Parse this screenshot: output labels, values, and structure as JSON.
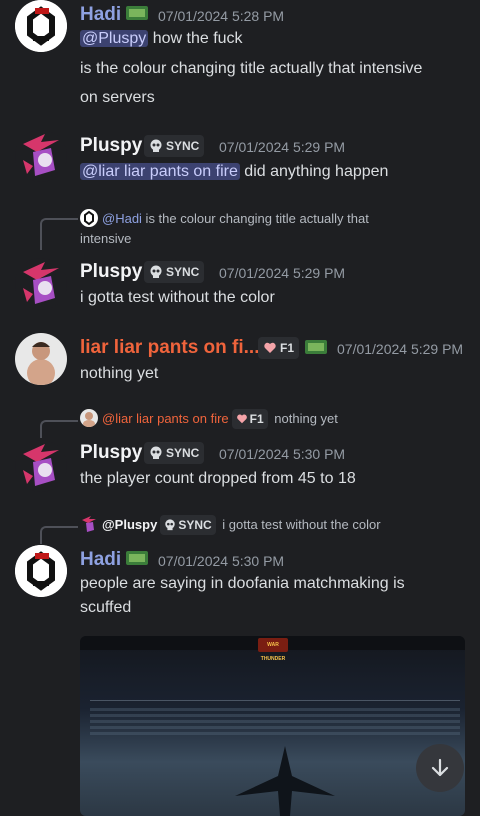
{
  "messages": [
    {
      "author": "Hadi",
      "timestamp": "07/01/2024 5:28 PM",
      "mention": "@Pluspy",
      "line1_rest": " how the fuck",
      "line2": "is the colour changing title actually that intensive",
      "line3": "on servers"
    },
    {
      "author": "Pluspy",
      "tag": "SYNC",
      "timestamp": "07/01/2024 5:29 PM",
      "mention": "@liar liar pants on fire",
      "line1_rest": " did anything happen"
    },
    {
      "reply": {
        "author": "@Hadi",
        "text": " is the colour changing title actually that",
        "text2": "intensive"
      },
      "author": "Pluspy",
      "tag": "SYNC",
      "timestamp": "07/01/2024 5:29 PM",
      "line1": "i gotta test without the color"
    },
    {
      "author": "liar liar pants on fi...",
      "tag": "F1",
      "timestamp": "07/01/2024 5:29 PM",
      "line1": "nothing yet"
    },
    {
      "reply": {
        "author": "@liar liar pants on fire",
        "tag": "F1",
        "text": " nothing yet"
      },
      "author": "Pluspy",
      "tag": "SYNC",
      "timestamp": "07/01/2024 5:30 PM",
      "line1": "the player count dropped from 45 to 18"
    },
    {
      "reply": {
        "author": "@Pluspy",
        "tag": "SYNC",
        "text": " i gotta test without the color"
      },
      "author": "Hadi",
      "timestamp": "07/01/2024 5:30 PM",
      "line1": "people are saying in doofania matchmaking is",
      "line2": "scuffed"
    }
  ],
  "embed": {
    "logo_text": "WAR THUNDER"
  },
  "colors": {
    "hadi": "#8ea1e1",
    "liar": "#f0643c",
    "pluspy": "#f2f3f5",
    "mention_bg": "#3c4270",
    "background": "#1e1f22"
  },
  "icons": {
    "scroll": "arrow-down-icon",
    "skull": "skull-icon",
    "heart": "heart-icon",
    "flag": "pepe-flag-icon"
  }
}
